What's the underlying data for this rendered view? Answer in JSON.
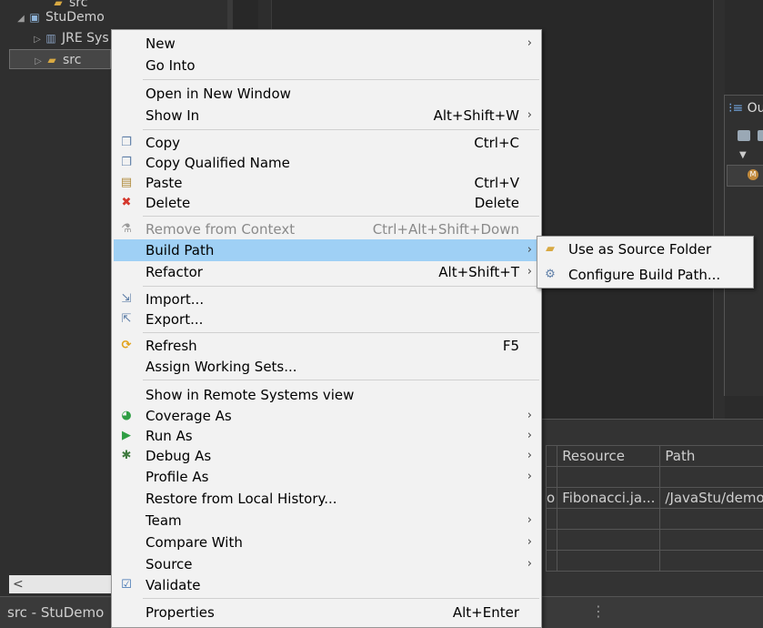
{
  "explorer": {
    "rows": [
      {
        "label": "src",
        "arrow": "",
        "icon": "folder-icon"
      },
      {
        "label": "StuDemo",
        "arrow": "◢",
        "icon": "project-icon"
      },
      {
        "label": "JRE Sys",
        "arrow": "▷",
        "icon": "library-icon"
      },
      {
        "label": "src",
        "arrow": "▷",
        "icon": "package-folder-icon"
      }
    ]
  },
  "outline": {
    "title": "Ou"
  },
  "problems_table": {
    "headers": [
      "Resource",
      "Path"
    ],
    "rows": [
      [
        "",
        ""
      ],
      [
        "Fibonacci.ja...",
        "/JavaStu/demo"
      ],
      [
        "",
        ""
      ],
      [
        "",
        ""
      ],
      [
        "",
        ""
      ]
    ],
    "row_prefix": "o"
  },
  "status": {
    "text": "src - StuDemo",
    "dots": "⋮"
  },
  "context_menu": {
    "items": [
      {
        "label": "New",
        "shortcut": "",
        "submenu": true,
        "icon": "",
        "disabled": false
      },
      {
        "label": "Go Into",
        "shortcut": "",
        "submenu": false,
        "icon": "",
        "disabled": false
      },
      {
        "label": "Open in New Window",
        "shortcut": "",
        "submenu": false,
        "icon": "",
        "disabled": false
      },
      {
        "label": "Show In",
        "shortcut": "Alt+Shift+W",
        "submenu": true,
        "icon": "",
        "disabled": false
      },
      {
        "label": "Copy",
        "shortcut": "Ctrl+C",
        "submenu": false,
        "icon": "copy-icon",
        "disabled": false
      },
      {
        "label": "Copy Qualified Name",
        "shortcut": "",
        "submenu": false,
        "icon": "copy-qualified-name-icon",
        "disabled": false
      },
      {
        "label": "Paste",
        "shortcut": "Ctrl+V",
        "submenu": false,
        "icon": "paste-icon",
        "disabled": false
      },
      {
        "label": "Delete",
        "shortcut": "Delete",
        "submenu": false,
        "icon": "delete-icon",
        "disabled": false
      },
      {
        "label": "Remove from Context",
        "shortcut": "Ctrl+Alt+Shift+Down",
        "submenu": false,
        "icon": "remove-from-context-icon",
        "disabled": true
      },
      {
        "label": "Build Path",
        "shortcut": "",
        "submenu": true,
        "icon": "",
        "disabled": false,
        "highlighted": true
      },
      {
        "label": "Refactor",
        "shortcut": "Alt+Shift+T",
        "submenu": true,
        "icon": "",
        "disabled": false
      },
      {
        "label": "Import...",
        "shortcut": "",
        "submenu": false,
        "icon": "import-icon",
        "disabled": false
      },
      {
        "label": "Export...",
        "shortcut": "",
        "submenu": false,
        "icon": "export-icon",
        "disabled": false
      },
      {
        "label": "Refresh",
        "shortcut": "F5",
        "submenu": false,
        "icon": "refresh-icon",
        "disabled": false
      },
      {
        "label": "Assign Working Sets...",
        "shortcut": "",
        "submenu": false,
        "icon": "",
        "disabled": false
      },
      {
        "label": "Show in Remote Systems view",
        "shortcut": "",
        "submenu": false,
        "icon": "",
        "disabled": false
      },
      {
        "label": "Coverage As",
        "shortcut": "",
        "submenu": true,
        "icon": "coverage-icon",
        "disabled": false
      },
      {
        "label": "Run As",
        "shortcut": "",
        "submenu": true,
        "icon": "run-icon",
        "disabled": false
      },
      {
        "label": "Debug As",
        "shortcut": "",
        "submenu": true,
        "icon": "debug-icon",
        "disabled": false
      },
      {
        "label": "Profile As",
        "shortcut": "",
        "submenu": true,
        "icon": "",
        "disabled": false
      },
      {
        "label": "Restore from Local History...",
        "shortcut": "",
        "submenu": false,
        "icon": "",
        "disabled": false
      },
      {
        "label": "Team",
        "shortcut": "",
        "submenu": true,
        "icon": "",
        "disabled": false
      },
      {
        "label": "Compare With",
        "shortcut": "",
        "submenu": true,
        "icon": "",
        "disabled": false
      },
      {
        "label": "Source",
        "shortcut": "",
        "submenu": true,
        "icon": "",
        "disabled": false
      },
      {
        "label": "Validate",
        "shortcut": "",
        "submenu": false,
        "icon": "validate-check-icon",
        "disabled": false
      },
      {
        "label": "Properties",
        "shortcut": "Alt+Enter",
        "submenu": false,
        "icon": "",
        "disabled": false
      }
    ]
  },
  "submenu": {
    "items": [
      {
        "label": "Use as Source Folder",
        "icon": "source-folder-icon"
      },
      {
        "label": "Configure Build Path...",
        "icon": "configure-build-path-icon"
      }
    ]
  },
  "colors": {
    "highlight": "#9fd0f5",
    "menu_bg": "#f2f2f2",
    "ide_bg": "#2b2b2b"
  }
}
